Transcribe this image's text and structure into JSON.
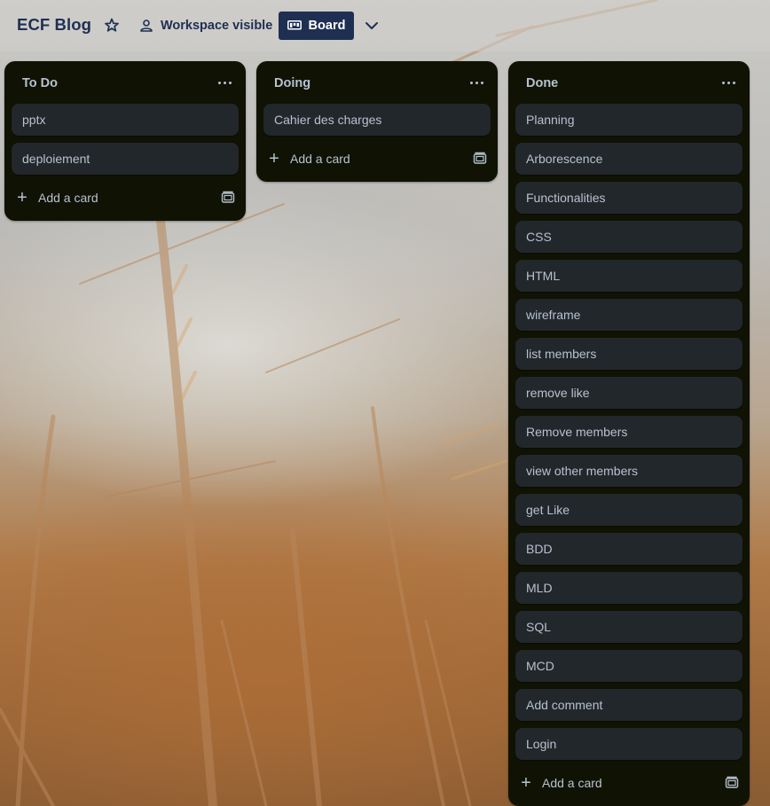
{
  "header": {
    "board_title": "ECF Blog",
    "visibility_label": "Workspace visible",
    "view_label": "Board"
  },
  "colors": {
    "header_text": "#1f2f52",
    "board_button_bg": "#1f2f52",
    "list_bg": "#101204",
    "card_bg": "#22272b",
    "card_text": "#b6c2cf"
  },
  "icons": {
    "star": "star-icon",
    "visibility": "people-icon",
    "board": "board-icon",
    "dropdown": "chevron-down-icon",
    "list_menu": "more-icon",
    "add": "plus-icon",
    "template": "card-template-icon"
  },
  "lists": [
    {
      "title": "To Do",
      "cards": [
        "pptx",
        "deploiement"
      ],
      "add_label": "Add a card"
    },
    {
      "title": "Doing",
      "cards": [
        "Cahier des charges"
      ],
      "add_label": "Add a card"
    },
    {
      "title": "Done",
      "cards": [
        "Planning",
        "Arborescence",
        "Functionalities",
        "CSS",
        "HTML",
        "wireframe",
        "list members",
        "remove like",
        "Remove members",
        "view other members",
        "get Like",
        "BDD",
        "MLD",
        "SQL",
        "MCD",
        "Add comment",
        "Login"
      ],
      "add_label": "Add a card"
    }
  ]
}
